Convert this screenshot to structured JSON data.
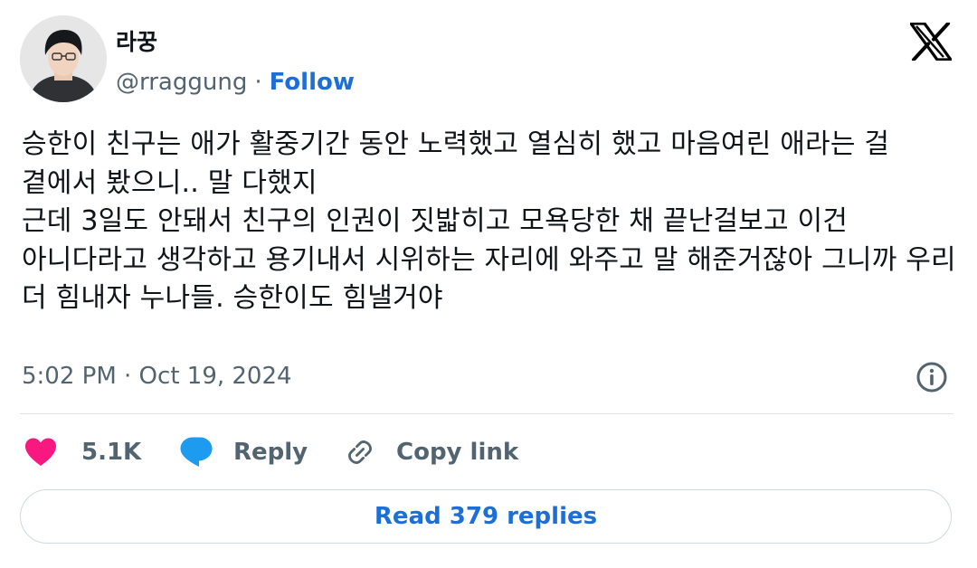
{
  "author": {
    "display_name": "라꿍",
    "handle": "@rraggung",
    "separator": "·",
    "follow_label": "Follow"
  },
  "tweet": {
    "text": "승한이 친구는 애가 활중기간 동안 노력했고 열심히 했고 마음여린 애라는 걸 곁에서 봤으니.. 말 다했지\n근데 3일도 안돼서 친구의 인권이 짓밟히고 모욕당한 채 끝난걸보고 이건 아니다라고 생각하고 용기내서 시위하는 자리에 와주고 말 해준거잖아 그니까 우리 더 힘내자 누나들. 승한이도 힘낼거야",
    "timestamp": "5:02 PM · Oct 19, 2024"
  },
  "actions": {
    "like_count": "5.1K",
    "reply_label": "Reply",
    "copy_link_label": "Copy link"
  },
  "footer": {
    "read_replies_label": "Read 379 replies"
  },
  "icons": {
    "brand": "x-logo-icon",
    "info": "info-icon",
    "like": "heart-icon",
    "reply": "speech-bubble-icon",
    "copy": "link-icon"
  },
  "colors": {
    "text": "#0f1419",
    "secondary": "#536471",
    "link": "#1d6fd6",
    "heart": "#f91880",
    "reply_bubble": "#1d9bf0",
    "border": "#cfd9de"
  }
}
